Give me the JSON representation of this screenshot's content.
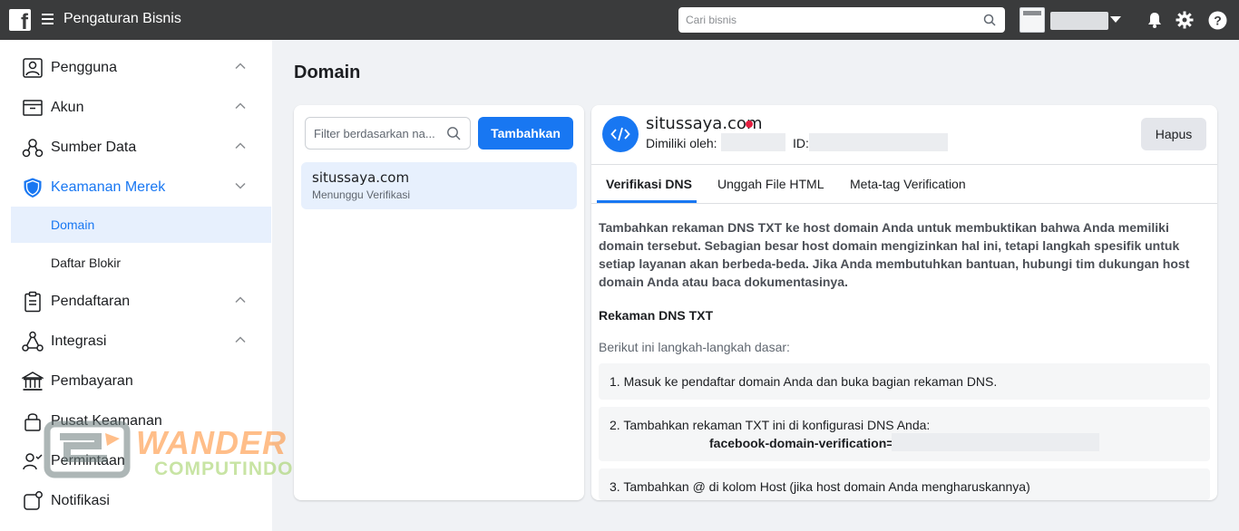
{
  "topbar": {
    "logo_icon": "facebook-icon",
    "menu_icon": "hamburger-icon",
    "title": "Pengaturan Bisnis",
    "search_placeholder": "Cari bisnis",
    "icons": [
      "bell-icon",
      "gear-icon",
      "help-icon"
    ]
  },
  "sidebar": {
    "items": [
      {
        "label": "Pengguna",
        "icon": "user-icon"
      },
      {
        "label": "Akun",
        "icon": "account-box-icon"
      },
      {
        "label": "Sumber Data",
        "icon": "data-source-icon"
      },
      {
        "label": "Keamanan Merek",
        "icon": "shield-icon"
      },
      {
        "label": "Pendaftaran",
        "icon": "clipboard-icon"
      },
      {
        "label": "Integrasi",
        "icon": "integration-icon"
      },
      {
        "label": "Pembayaran",
        "icon": "bank-icon"
      },
      {
        "label": "Pusat Keamanan",
        "icon": "lock-icon"
      },
      {
        "label": "Permintaan",
        "icon": "user-check-icon"
      },
      {
        "label": "Notifikasi",
        "icon": "notification-icon"
      }
    ],
    "subitems": [
      {
        "label": "Domain"
      },
      {
        "label": "Daftar Blokir"
      }
    ]
  },
  "page": {
    "title": "Domain"
  },
  "domain_list": {
    "filter_placeholder": "Filter berdasarkan na...",
    "add_label": "Tambahkan",
    "items": [
      {
        "name": "situssaya.com",
        "status": "Menunggu Verifikasi"
      }
    ]
  },
  "detail": {
    "domain": "situssaya.com",
    "owned_by_label": "Dimiliki oleh:",
    "id_label": "ID:",
    "delete_label": "Hapus",
    "tabs": [
      "Verifikasi DNS",
      "Unggah File HTML",
      "Meta-tag Verification"
    ],
    "description": "Tambahkan rekaman DNS TXT ke host domain Anda untuk membuktikan bahwa Anda memiliki domain tersebut. Sebagian besar host domain mengizinkan hal ini, tetapi langkah spesifik untuk setiap layanan akan berbeda-beda. Jika Anda membutuhkan bantuan, hubungi tim dukungan host domain Anda atau baca dokumentasinya.",
    "section_title": "Rekaman DNS TXT",
    "basic_steps_label": "Berikut ini langkah-langkah dasar:",
    "steps": [
      "1. Masuk ke pendaftar domain Anda dan buka bagian rekaman DNS.",
      "2. Tambahkan rekaman TXT ini di konfigurasi DNS Anda:",
      "3. Tambahkan @ di kolom Host (jika host domain Anda mengharuskannya)"
    ],
    "txt_record_prefix": "facebook-domain-verification=("
  },
  "watermark": {
    "line1": "WANDER",
    "line2": "COMPUTINDO"
  },
  "colors": {
    "accent": "#1877f2",
    "topbar": "#3a3b3c",
    "status_dot": "#e41e3f"
  }
}
